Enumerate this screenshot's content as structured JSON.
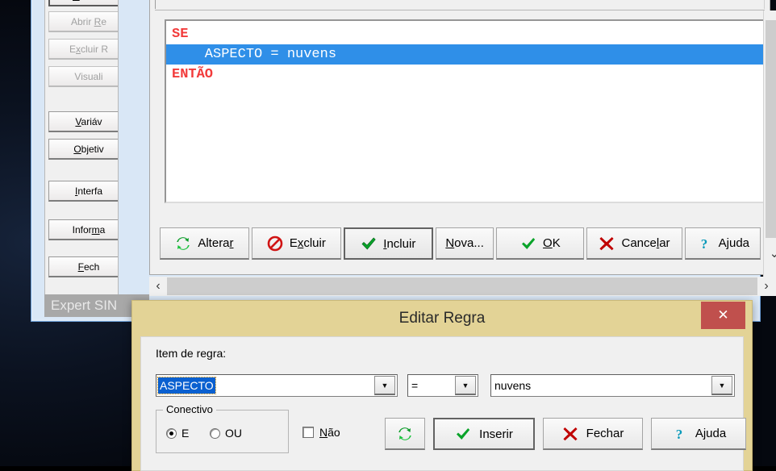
{
  "desktop": {
    "name": "desktop-background"
  },
  "app_window": {
    "status_text": "Expert SIN",
    "sidebar": {
      "items": [
        {
          "label": "Nova R",
          "enabled": true,
          "accel": "N",
          "name": "sidebar-nova-regra"
        },
        {
          "label": "Abrir Re",
          "enabled": false,
          "accel": "R",
          "name": "sidebar-abrir-regra"
        },
        {
          "label": "Excluir R",
          "enabled": false,
          "accel": "x",
          "name": "sidebar-excluir-regra"
        },
        {
          "label": "Visuali",
          "enabled": false,
          "accel": "",
          "name": "sidebar-visualizar"
        },
        {
          "label": "Variáv",
          "enabled": true,
          "accel": "V",
          "name": "sidebar-variaveis"
        },
        {
          "label": "Objetiv",
          "enabled": true,
          "accel": "O",
          "name": "sidebar-objetivos"
        },
        {
          "label": "Interfa",
          "enabled": true,
          "accel": "I",
          "name": "sidebar-interface"
        },
        {
          "label": "Informa",
          "enabled": true,
          "accel": "m",
          "name": "sidebar-informacoes"
        },
        {
          "label": "Fech",
          "enabled": true,
          "accel": "F",
          "name": "sidebar-fechar"
        }
      ]
    },
    "rule_editor": {
      "lines": [
        {
          "text": "SE",
          "selected": false
        },
        {
          "text": "    ASPECTO = nuvens",
          "selected": true
        },
        {
          "text": "ENTÃO",
          "selected": false
        }
      ],
      "buttons": [
        {
          "label": "Alterar",
          "icon": "refresh-icon",
          "pressed": false,
          "name": "alterar-button"
        },
        {
          "label": "Excluir",
          "icon": "forbidden-icon",
          "pressed": false,
          "name": "excluir-button"
        },
        {
          "label": "Incluir",
          "icon": "check-icon",
          "pressed": true,
          "name": "incluir-button"
        },
        {
          "label": "Nova...",
          "icon": "none",
          "pressed": false,
          "name": "nova-button"
        },
        {
          "label": "OK",
          "icon": "check-icon",
          "pressed": false,
          "name": "ok-button"
        },
        {
          "label": "Cancelar",
          "icon": "x-icon",
          "pressed": false,
          "name": "cancelar-button"
        },
        {
          "label": "Ajuda",
          "icon": "question-icon",
          "pressed": false,
          "name": "ajuda-button"
        }
      ]
    },
    "scrollbars": {
      "v_down_glyph": "⌄",
      "h_left_glyph": "‹",
      "h_right_glyph": "›"
    }
  },
  "dialog": {
    "title": "Editar Regra",
    "close_label": "✕",
    "item_label": "Item de regra:",
    "item_value": "ASPECTO",
    "operator_value": "=",
    "value_value": "nuvens",
    "arrow_glyph": "▼",
    "group": {
      "legend": "Conectivo",
      "radio_e": "E",
      "radio_ou": "OU",
      "selected": "E"
    },
    "checkbox_nao": {
      "label": "Não",
      "accel": "N",
      "checked": false
    },
    "buttons": [
      {
        "label": "",
        "icon": "refresh-icon",
        "pressed": false,
        "name": "dialog-refresh-button"
      },
      {
        "label": "Inserir",
        "icon": "check-icon",
        "pressed": true,
        "name": "dialog-inserir-button"
      },
      {
        "label": "Fechar",
        "icon": "x-icon",
        "pressed": false,
        "name": "dialog-fechar-button"
      },
      {
        "label": "Ajuda",
        "icon": "question-icon",
        "pressed": false,
        "name": "dialog-ajuda-button"
      }
    ]
  },
  "colors": {
    "title_bar": "#e3d396",
    "close_button": "#c0504d",
    "selection_blue": "#2f8fe8",
    "keyword_red": "#ff2b2b",
    "status_gray": "#a8a8a8"
  }
}
